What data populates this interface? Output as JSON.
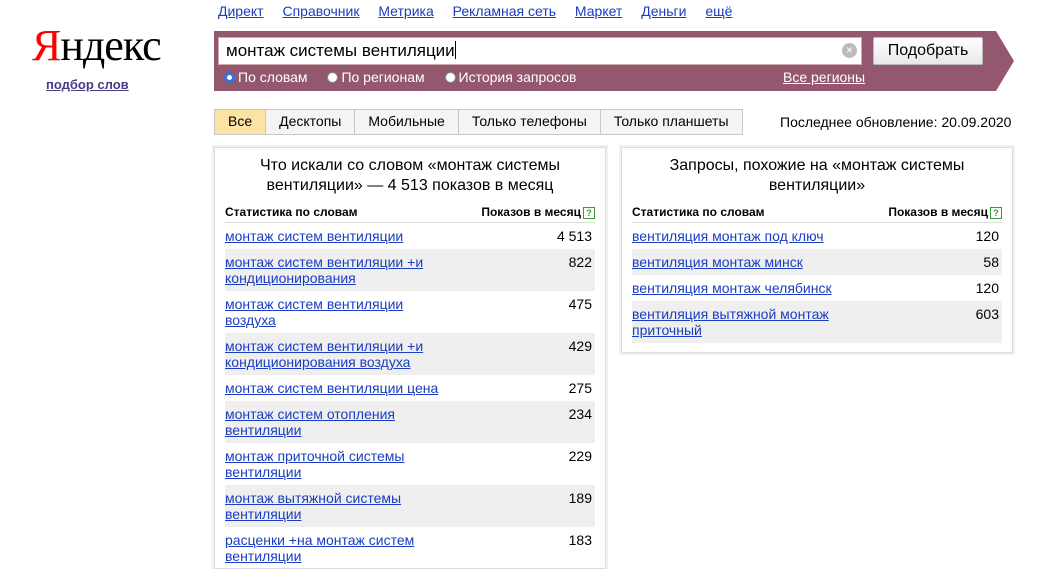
{
  "logo": {
    "first_letter": "Я",
    "rest": "ндекс"
  },
  "subtitle": "подбор слов",
  "nav": [
    "Директ",
    "Справочник",
    "Метрика",
    "Рекламная сеть",
    "Маркет",
    "Деньги",
    "ещё"
  ],
  "search": {
    "value": "монтаж системы вентиляции",
    "button": "Подобрать",
    "clear_icon": "×",
    "modes": [
      "По словам",
      "По регионам",
      "История запросов"
    ],
    "selected_mode": "По словам",
    "regions_link": "Все регионы"
  },
  "tabs": [
    "Все",
    "Десктопы",
    "Мобильные",
    "Только телефоны",
    "Только планшеты"
  ],
  "active_tab": "Все",
  "updated": "Последнее обновление: 20.09.2020",
  "left_panel": {
    "title": "Что искали со словом «монтаж системы вентиляции» — 4 513 показов в месяц",
    "col_query": "Статистика по словам",
    "col_count": "Показов в месяц",
    "help_icon": "?",
    "rows": [
      {
        "q": "монтаж систем вентиляции",
        "n": "4 513"
      },
      {
        "q": "монтаж систем вентиляции +и кондиционирования",
        "n": "822"
      },
      {
        "q": "монтаж систем вентиляции воздуха",
        "n": "475"
      },
      {
        "q": "монтаж систем вентиляции +и кондиционирования воздуха",
        "n": "429"
      },
      {
        "q": "монтаж систем вентиляции цена",
        "n": "275"
      },
      {
        "q": "монтаж систем отопления вентиляции",
        "n": "234"
      },
      {
        "q": "монтаж приточной системы вентиляции",
        "n": "229"
      },
      {
        "q": "монтаж вытяжной системы вентиляции",
        "n": "189"
      },
      {
        "q": "расценки +на монтаж систем вентиляции",
        "n": "183"
      }
    ]
  },
  "right_panel": {
    "title": "Запросы, похожие на «монтаж системы вентиляции»",
    "col_query": "Статистика по словам",
    "col_count": "Показов в месяц",
    "help_icon": "?",
    "rows": [
      {
        "q": "вентиляция монтаж под ключ",
        "n": "120"
      },
      {
        "q": "вентиляция монтаж минск",
        "n": "58"
      },
      {
        "q": "вентиляция монтаж челябинск",
        "n": "120"
      },
      {
        "q": "вентиляция вытяжной монтаж приточный",
        "n": "603"
      }
    ]
  }
}
